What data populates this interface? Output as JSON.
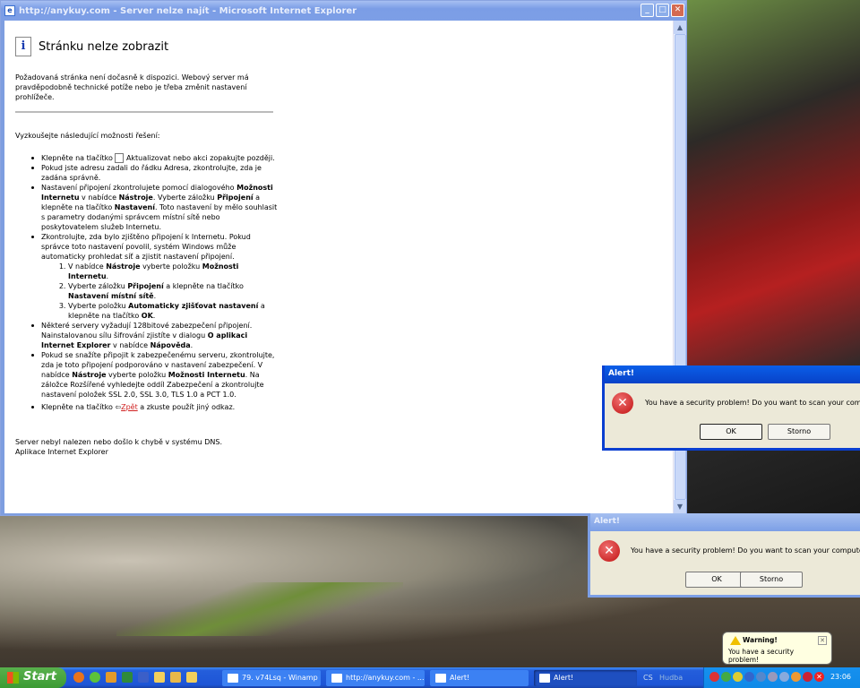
{
  "ie": {
    "title": "http://anykuy.com - Server nelze najít - Microsoft Internet Explorer",
    "heading": "Stránku nelze zobrazit",
    "intro": "Požadovaná stránka není dočasně k dispozici. Webový server má pravděpodobně technické potíže nebo je třeba změnit nastavení prohlížeče.",
    "try": "Vyzkoušejte následující možnosti řešení:",
    "b1a": "Klepněte na tlačítko",
    "b1b": "Aktualizovat nebo akci zopakujte později.",
    "b2": "Pokud jste adresu zadali do řádku Adresa, zkontrolujte, zda je zadána správně.",
    "b3": [
      "Nastavení připojení zkontrolujete pomocí dialogového ",
      "Možnosti Internetu",
      " v nabídce ",
      "Nástroje",
      ". Vyberte záložku ",
      "Připojení",
      " a klepněte na tlačítko ",
      "Nastavení",
      ". Toto nastavení by mělo souhlasit s parametry dodanými správcem místní sítě nebo poskytovatelem služeb Internetu."
    ],
    "b4": "Zkontrolujte, zda bylo zjištěno připojení k Internetu. Pokud správce toto nastavení povolil, systém Windows může automaticky prohledat síť a zjistit nastavení připojení.",
    "s1": [
      "V nabídce ",
      "Nástroje",
      " vyberte položku ",
      "Možnosti Internetu",
      "."
    ],
    "s2": [
      "Vyberte záložku ",
      "Připojení",
      " a klepněte na tlačítko ",
      "Nastavení místní sítě",
      "."
    ],
    "s3": [
      "Vyberte položku ",
      "Automaticky zjišťovat nastavení",
      " a klepněte na tlačítko ",
      "OK",
      "."
    ],
    "b5": [
      "Některé servery vyžadují 128bitové zabezpečení připojení. Nainstalovanou sílu šifrování zjistíte v dialogu ",
      "O aplikaci Internet Explorer",
      " v nabídce ",
      "Nápověda",
      "."
    ],
    "b6": [
      "Pokud se snažíte připojit k zabezpečenému serveru, zkontrolujte, zda je toto připojení podporováno v nastavení zabezpečení. V nabídce ",
      "Nástroje",
      " vyberte položku ",
      "Možnosti Internetu",
      ". Na záložce Rozšířené vyhledejte oddíl Zabezpečení a zkontrolujte nastavení položek SSL 2.0, SSL 3.0, TLS 1.0 a PCT 1.0."
    ],
    "b7a": "Klepněte na tlačítko",
    "b7link": "Zpět",
    "b7b": "a zkuste použít jiný odkaz.",
    "foot1": "Server nebyl nalezen nebo došlo k chybě v systému DNS.",
    "foot2": "Aplikace Internet Explorer"
  },
  "alert1": {
    "title": "Alert!",
    "message": "You have a security problem! Do you want to scan your computer f",
    "ok": "OK",
    "cancel": "Storno"
  },
  "alert2": {
    "title": "Alert!",
    "message": "You have a security problem! Do you want to scan your computer for v",
    "ok": "OK",
    "cancel": "Storno"
  },
  "taskbar": {
    "start": "Start",
    "tasks": [
      "79. v74Lsq - Winamp",
      "http://anykuy.com - ...",
      "Alert!",
      "Alert!"
    ],
    "lang": "CS",
    "hudba": "Hudba",
    "clock": "23:06"
  },
  "balloon": {
    "title": "Warning!",
    "text": "You have a security problem!"
  }
}
